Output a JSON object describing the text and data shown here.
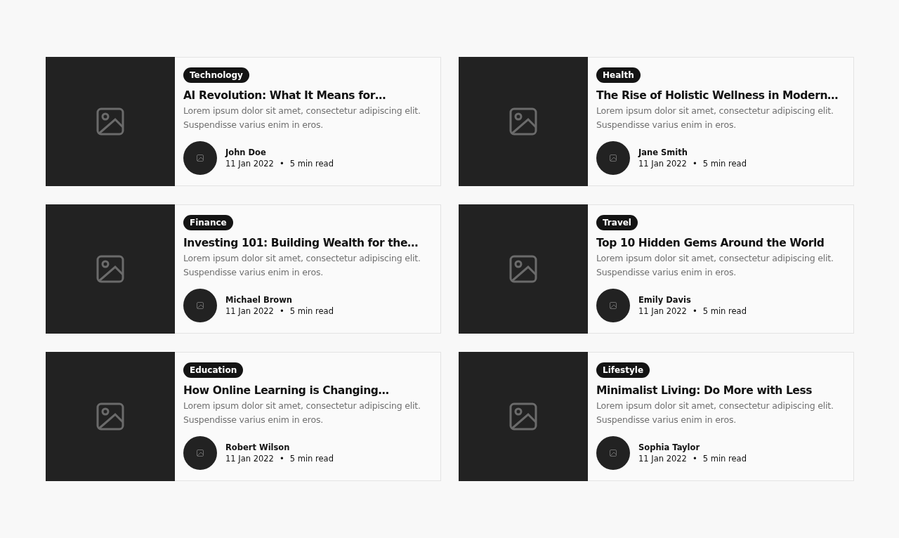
{
  "articles": [
    {
      "category": "Technology",
      "title": "AI Revolution: What It Means for…",
      "excerpt": "Lorem ipsum dolor sit amet, consectetur adipiscing elit. Suspendisse varius enim in eros.",
      "author": "John Doe",
      "date": "11 Jan 2022",
      "separator": "•",
      "read_time": "5 min read"
    },
    {
      "category": "Health",
      "title": "The Rise of Holistic Wellness in Modern…",
      "excerpt": "Lorem ipsum dolor sit amet, consectetur adipiscing elit. Suspendisse varius enim in eros.",
      "author": "Jane Smith",
      "date": "11 Jan 2022",
      "separator": "•",
      "read_time": "5 min read"
    },
    {
      "category": "Finance",
      "title": "Investing 101: Building Wealth for the…",
      "excerpt": "Lorem ipsum dolor sit amet, consectetur adipiscing elit. Suspendisse varius enim in eros.",
      "author": "Michael Brown",
      "date": "11 Jan 2022",
      "separator": "•",
      "read_time": "5 min read"
    },
    {
      "category": "Travel",
      "title": "Top 10 Hidden Gems Around the World",
      "excerpt": "Lorem ipsum dolor sit amet, consectetur adipiscing elit. Suspendisse varius enim in eros.",
      "author": "Emily Davis",
      "date": "11 Jan 2022",
      "separator": "•",
      "read_time": "5 min read"
    },
    {
      "category": "Education",
      "title": "How Online Learning is Changing…",
      "excerpt": "Lorem ipsum dolor sit amet, consectetur adipiscing elit. Suspendisse varius enim in eros.",
      "author": "Robert Wilson",
      "date": "11 Jan 2022",
      "separator": "•",
      "read_time": "5 min read"
    },
    {
      "category": "Lifestyle",
      "title": "Minimalist Living: Do More with Less",
      "excerpt": "Lorem ipsum dolor sit amet, consectetur adipiscing elit. Suspendisse varius enim in eros.",
      "author": "Sophia Taylor",
      "date": "11 Jan 2022",
      "separator": "•",
      "read_time": "5 min read"
    }
  ]
}
